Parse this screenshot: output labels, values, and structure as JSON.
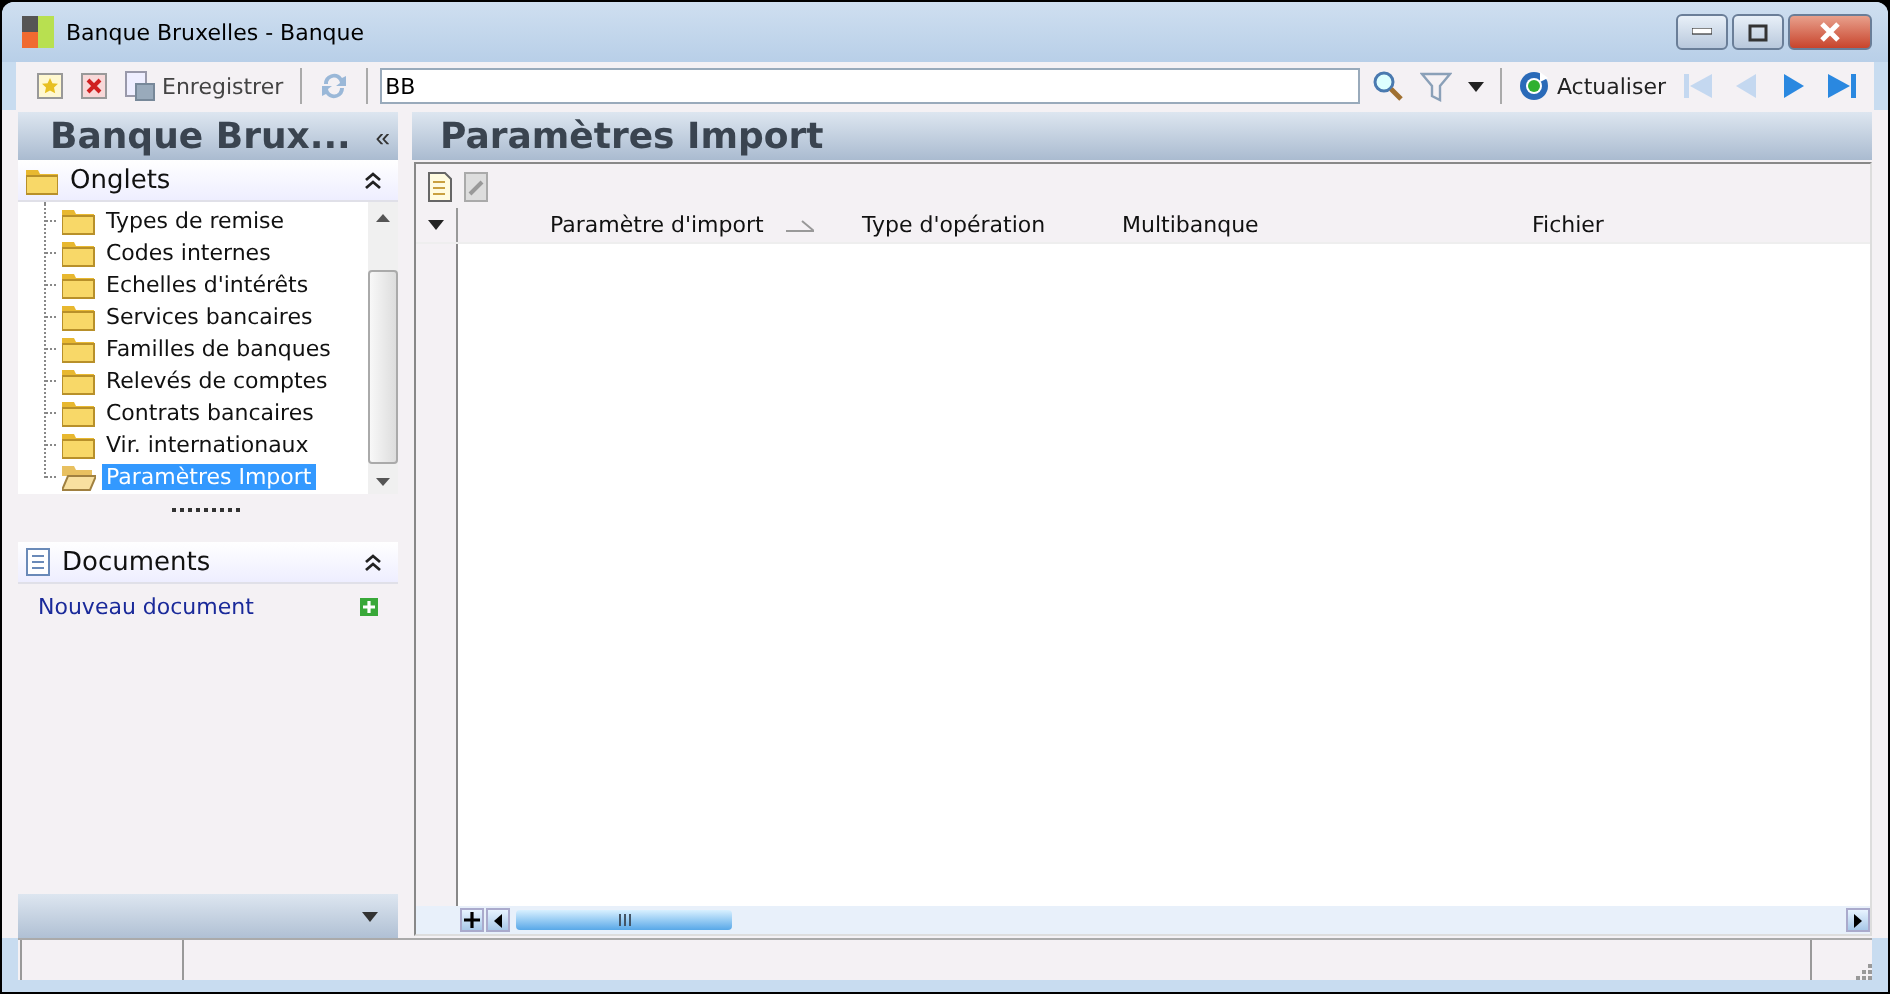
{
  "window": {
    "title": "Banque Bruxelles -  Banque"
  },
  "toolbar": {
    "save_label": "Enregistrer",
    "search": {
      "value": "BB"
    },
    "refresh_label": "Actualiser",
    "nav": [
      {
        "kind": "first",
        "disabled": true
      },
      {
        "kind": "prev",
        "disabled": true
      },
      {
        "kind": "next",
        "disabled": false
      },
      {
        "kind": "last",
        "disabled": false
      }
    ]
  },
  "sidebar": {
    "title": "Banque Brux...",
    "collapse": "«",
    "groups": [
      {
        "kind": "tree",
        "label": "Onglets",
        "expanded": true,
        "items": [
          {
            "label": "Types de remise",
            "selected": false
          },
          {
            "label": "Codes internes",
            "selected": false
          },
          {
            "label": "Echelles d'intérêts",
            "selected": false
          },
          {
            "label": "Services bancaires",
            "selected": false
          },
          {
            "label": "Familles de banques",
            "selected": false
          },
          {
            "label": "Relevés de comptes",
            "selected": false
          },
          {
            "label": "Contrats bancaires",
            "selected": false
          },
          {
            "label": "Vir. internationaux",
            "selected": false
          },
          {
            "label": "Paramètres Import",
            "selected": true
          }
        ]
      },
      {
        "kind": "links",
        "label": "Documents",
        "expanded": true,
        "items": [
          {
            "label": "Nouveau document"
          }
        ]
      }
    ]
  },
  "main": {
    "title": "Paramètres Import",
    "table": {
      "columns": [
        {
          "label": "Paramètre d'import",
          "sorted": true
        },
        {
          "label": "Type d'opération",
          "sorted": false
        },
        {
          "label": "Multibanque",
          "sorted": false
        },
        {
          "label": "Fichier",
          "sorted": false
        }
      ]
    }
  }
}
